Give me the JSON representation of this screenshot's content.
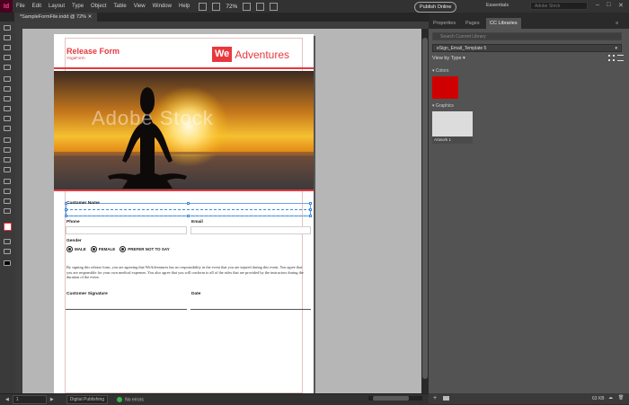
{
  "app": {
    "logo_text": "Id"
  },
  "menu": [
    "File",
    "Edit",
    "Layout",
    "Type",
    "Object",
    "Table",
    "View",
    "Window",
    "Help"
  ],
  "menubar": {
    "zoom": "72%",
    "publish_label": "Publish Online",
    "workspace": "Essentials",
    "search_placeholder": "Adobe Stock"
  },
  "document": {
    "tab_title": "*SampleFormFile.indd @ 72%"
  },
  "page": {
    "title": "Release Form",
    "subtitle": "YogaForm",
    "logo_we": "We",
    "logo_rest": "Adventures",
    "watermark": "Adobe Stock",
    "fields": {
      "customer_name": "Customer Name",
      "phone": "Phone",
      "email": "Email",
      "gender": "Gender",
      "customer_signature": "Customer Signature",
      "date": "Date"
    },
    "gender_options": [
      "MALE",
      "FEMALE",
      "PREFER NOT TO SAY"
    ],
    "disclaimer": "By signing this release form, you are agreeing that WeAdventures has no responsibility in the event that you are injured during this event. You agree that you are responsible for your own medical expenses. You also agree that you will conform to all of the rules that are provided by the instructors during the duration of the event."
  },
  "status": {
    "page_number": "1",
    "preflight_profile": "Digital Publishing",
    "errors": "No errors"
  },
  "panel": {
    "tabs": [
      "Properties",
      "Pages",
      "CC Libraries"
    ],
    "active_tab": "CC Libraries",
    "search_placeholder": "Search Current Library",
    "library": "eSign_Email_Template 5",
    "view_by": "View by Type",
    "sections": {
      "colors": "Colors",
      "graphics": "Graphics"
    },
    "color_swatch": "#d10000",
    "graphic_name": "Artwork 1",
    "storage": "63 KB"
  },
  "colors": {
    "accent": "#e8383d",
    "selection": "#3a8bdc"
  }
}
